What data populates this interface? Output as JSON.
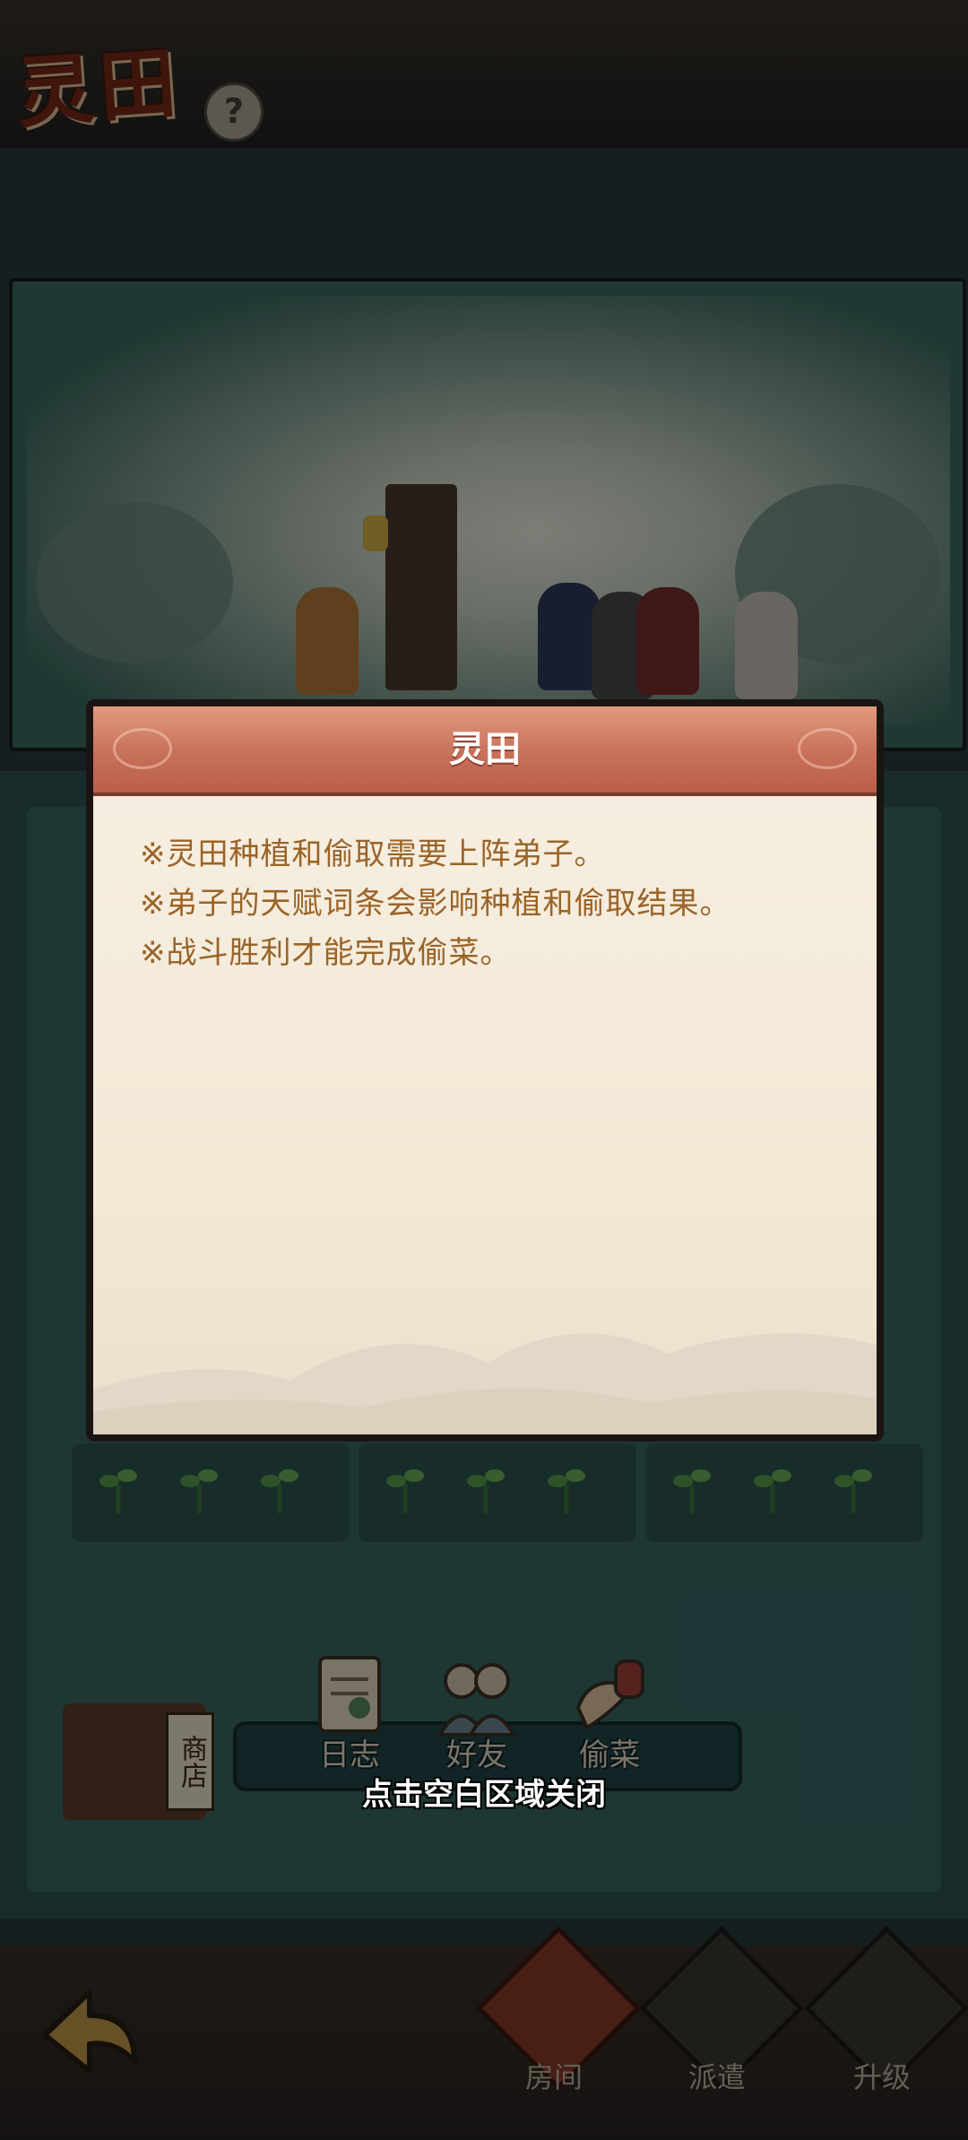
{
  "hud": {
    "title": "灵田",
    "help_label": "?"
  },
  "dialog": {
    "title": "灵田",
    "lines": [
      "※灵田种植和偷取需要上阵弟子。",
      "※弟子的天赋词条会影响种植和偷取结果。",
      "※战斗胜利才能完成偷菜。"
    ]
  },
  "tray": {
    "shop_label": "商店",
    "items": [
      {
        "label": "日志",
        "icon": "scroll-icon"
      },
      {
        "label": "好友",
        "icon": "friends-icon"
      },
      {
        "label": "偷菜",
        "icon": "steal-icon"
      }
    ]
  },
  "bottom_nav": {
    "back_icon": "back-arrow-icon",
    "items": [
      {
        "label": "房间",
        "icon": "room-icon"
      },
      {
        "label": "派遣",
        "icon": "dispatch-icon"
      },
      {
        "label": "升级",
        "icon": "upgrade-icon"
      }
    ]
  },
  "close_hint": "点击空白区域关闭",
  "colors": {
    "header": "#c8705a",
    "paper": "#f3eadb",
    "text": "#9a6428"
  }
}
